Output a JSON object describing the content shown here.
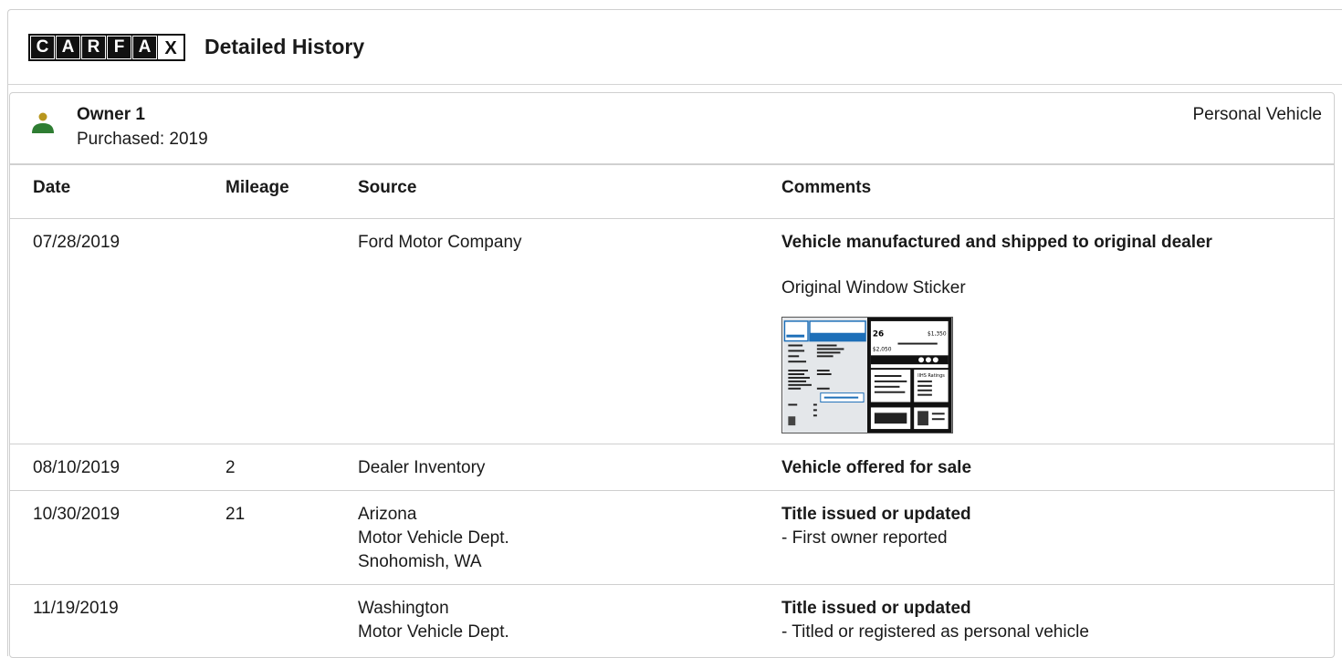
{
  "header": {
    "logo_letters": [
      "C",
      "A",
      "R",
      "F",
      "A",
      "X"
    ],
    "title": "Detailed History"
  },
  "owner": {
    "name": "Owner 1",
    "purchased": "Purchased: 2019",
    "type": "Personal Vehicle",
    "icon": "person-icon",
    "icon_colors": {
      "head": "#b8961e",
      "body": "#2e7d32"
    }
  },
  "table": {
    "headers": {
      "date": "Date",
      "mileage": "Mileage",
      "source": "Source",
      "comments": "Comments"
    },
    "rows": [
      {
        "date": "07/28/2019",
        "mileage": "",
        "source": [
          "Ford Motor Company"
        ],
        "comment_title": "Vehicle manufactured and shipped to original dealer",
        "comment_details": [],
        "sticker_label": "Original Window Sticker",
        "sticker": {
          "mpg": "26",
          "price1": "$1,350",
          "price2": "$2,050",
          "ratings": "IIHS Ratings",
          "icon": "window-sticker-thumbnail"
        }
      },
      {
        "date": "08/10/2019",
        "mileage": "2",
        "source": [
          "Dealer Inventory"
        ],
        "comment_title": "Vehicle offered for sale",
        "comment_details": []
      },
      {
        "date": "10/30/2019",
        "mileage": "21",
        "source": [
          "Arizona",
          "Motor Vehicle Dept.",
          "Snohomish, WA"
        ],
        "comment_title": "Title issued or updated",
        "comment_details": [
          "- First owner reported"
        ]
      },
      {
        "date": "11/19/2019",
        "mileage": "",
        "source": [
          "Washington",
          "Motor Vehicle Dept."
        ],
        "comment_title": "Title issued or updated",
        "comment_details": [
          "- Titled or registered as personal vehicle"
        ]
      }
    ]
  }
}
